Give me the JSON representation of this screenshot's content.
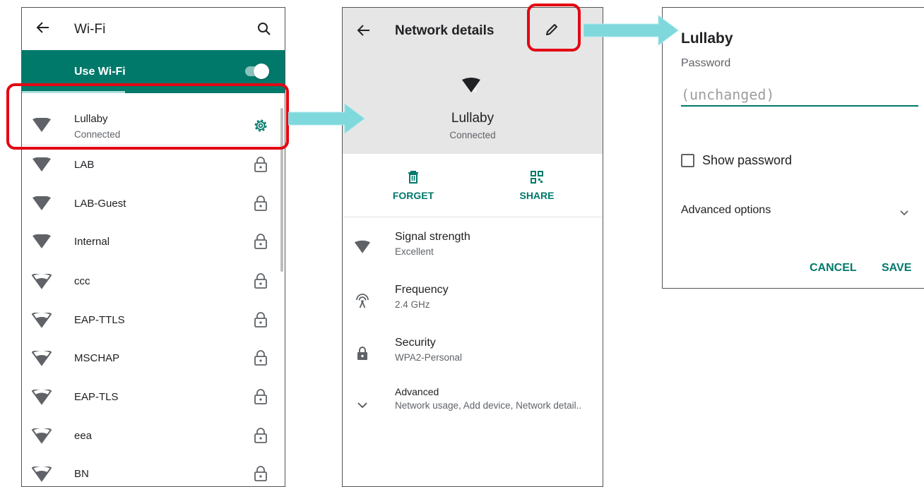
{
  "wifi_list": {
    "title": "Wi-Fi",
    "use_wifi_label": "Use Wi-Fi",
    "networks": [
      {
        "name": "Lullaby",
        "status": "Connected"
      },
      {
        "name": "LAB"
      },
      {
        "name": "LAB-Guest"
      },
      {
        "name": "Internal"
      },
      {
        "name": "ccc"
      },
      {
        "name": "EAP-TTLS"
      },
      {
        "name": "MSCHAP"
      },
      {
        "name": "EAP-TLS"
      },
      {
        "name": "eea"
      },
      {
        "name": "BN"
      }
    ]
  },
  "network_details": {
    "title": "Network details",
    "network_name": "Lullaby",
    "network_status": "Connected",
    "forget_label": "FORGET",
    "share_label": "SHARE",
    "details": [
      {
        "title": "Signal strength",
        "value": "Excellent",
        "icon": "wifi-signal-icon"
      },
      {
        "title": "Frequency",
        "value": "2.4 GHz",
        "icon": "antenna-icon"
      },
      {
        "title": "Security",
        "value": "WPA2-Personal",
        "icon": "lock-icon"
      },
      {
        "title": "Advanced",
        "value": "Network usage, Add device, Network detail..",
        "icon": "chevron-down-icon"
      }
    ]
  },
  "edit_dialog": {
    "title": "Lullaby",
    "password_label": "Password",
    "password_placeholder": "(unchanged)",
    "show_password_label": "Show password",
    "advanced_options_label": "Advanced options",
    "cancel_label": "CANCEL",
    "save_label": "SAVE"
  },
  "colors": {
    "accent": "#00796b",
    "highlight": "#e30613",
    "arrow": "#7fd8dc"
  }
}
